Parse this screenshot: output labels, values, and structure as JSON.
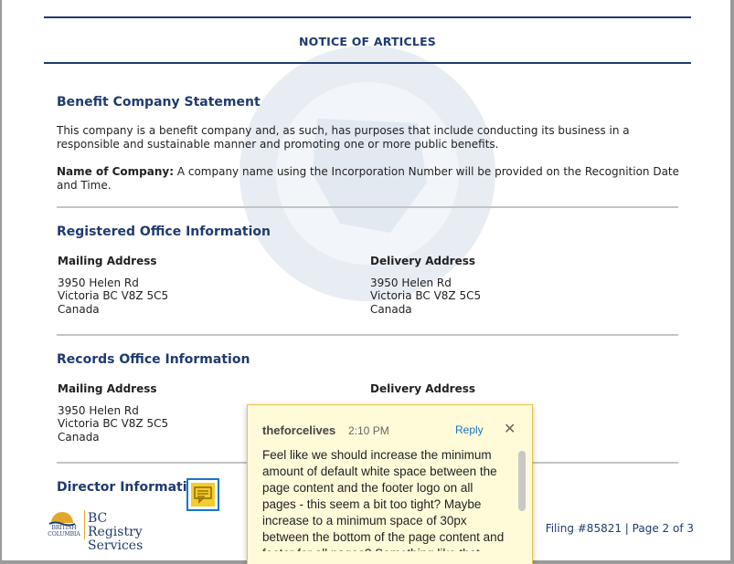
{
  "document": {
    "title": "NOTICE OF ARTICLES",
    "benefit": {
      "heading": "Benefit Company Statement",
      "statement": "This company is a benefit company and, as such, has purposes that include conducting its business in a responsible and sustainable manner and promoting one or more public benefits.",
      "name_label": "Name of Company:",
      "name_value": " A company name using the Incorporation Number will be provided on the Recognition Date and Time."
    },
    "registered_office": {
      "heading": "Registered Office Information",
      "mailing_label": "Mailing Address",
      "delivery_label": "Delivery Address",
      "mailing": [
        "3950 Helen Rd",
        "Victoria BC  V8Z 5C5",
        "Canada"
      ],
      "delivery": [
        "3950 Helen Rd",
        "Victoria BC  V8Z 5C5",
        "Canada"
      ]
    },
    "records_office": {
      "heading": "Records Office Information",
      "mailing_label": "Mailing Address",
      "delivery_label": "Delivery Address",
      "mailing": [
        "3950 Helen Rd",
        "Victoria BC  V8Z 5C5",
        "Canada"
      ]
    },
    "director": {
      "heading": "Director Information"
    }
  },
  "footer": {
    "logo_small": [
      "BRITISH",
      "COLUMBIA"
    ],
    "logo_text": [
      "BC Registry",
      "Services"
    ],
    "filing": "Filing #85821  |  Page 2 of 3"
  },
  "comment": {
    "author": "theforcelives",
    "time": "2:10 PM",
    "reply_label": "Reply",
    "close_glyph": "✕",
    "body": "Feel like we should increase the minimum amount of default white space between the page content and the footer logo on all pages - this seem a bit too tight? Maybe increase to a minimum space of 30px between the bottom of the page content and footer for all pages? Something like that."
  },
  "colors": {
    "accent": "#1f3b6e",
    "note": "#f4cc2c",
    "popup_bg": "#fffbd8",
    "link": "#1a73c9"
  }
}
